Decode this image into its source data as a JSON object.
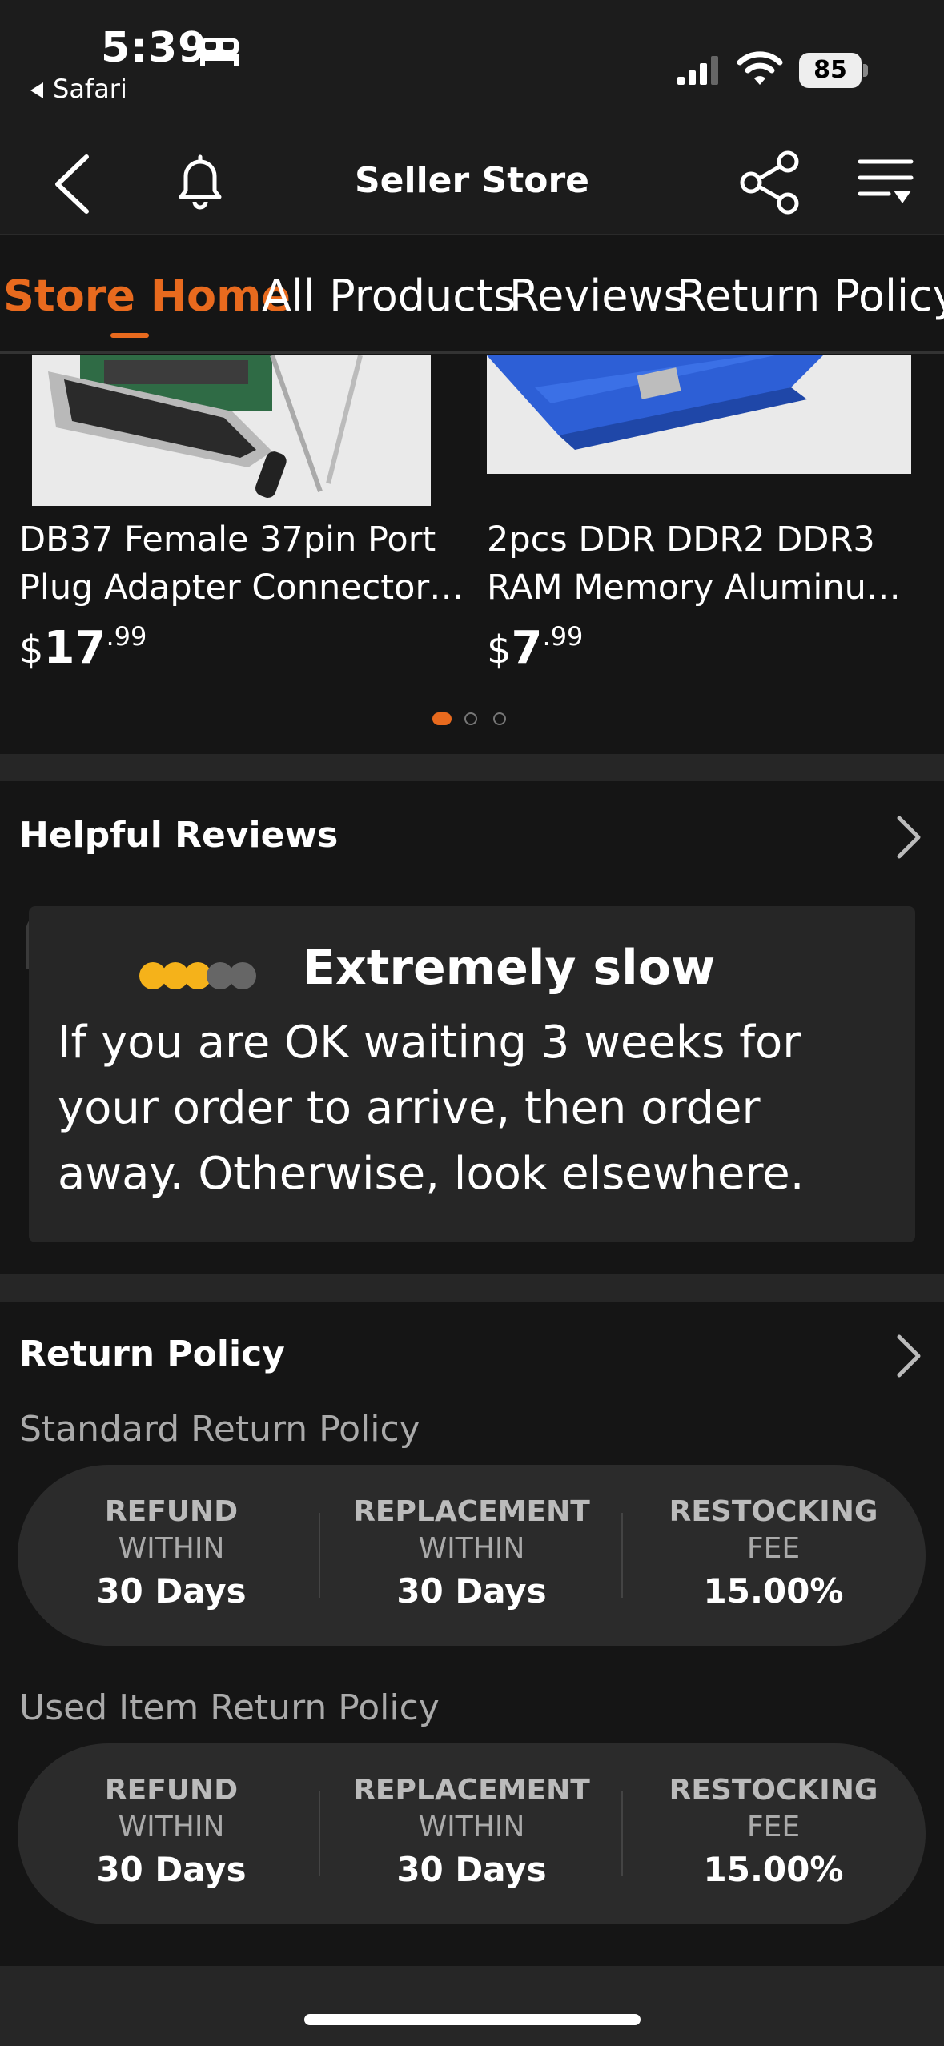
{
  "status_bar": {
    "time": "5:39",
    "back_app": "Safari",
    "battery": "85"
  },
  "nav": {
    "title": "Seller Store"
  },
  "tabs": [
    {
      "label": "Store Home",
      "active": true
    },
    {
      "label": "All Products",
      "active": false
    },
    {
      "label": "Reviews",
      "active": false
    },
    {
      "label": "Return Policy",
      "active": false
    }
  ],
  "products": [
    {
      "name_line1": "DB37 Female 37pin Port",
      "name_line2": "Plug Adapter Connector…",
      "currency": "$",
      "price_whole": "17",
      "price_cents": ".99"
    },
    {
      "name_line1": "2pcs DDR DDR2 DDR3",
      "name_line2": "RAM Memory Aluminu…",
      "currency": "$",
      "price_whole": "7",
      "price_cents": ".99"
    }
  ],
  "carousel": {
    "pages": 3,
    "active_page": 1
  },
  "reviews": {
    "section_title": "Helpful Reviews",
    "rating": 3,
    "rating_max": 5,
    "review_title": "Extremely slow",
    "review_line1": "If you are OK waiting 3 weeks for",
    "review_line2": "your order to arrive, then order",
    "review_line3": "away.  Otherwise, look elsewhere."
  },
  "return_policy": {
    "section_title": "Return Policy",
    "policies": [
      {
        "label": "Standard Return Policy",
        "columns": [
          {
            "head": "REFUND",
            "sub": "WITHIN",
            "value": "30 Days"
          },
          {
            "head": "REPLACEMENT",
            "sub": "WITHIN",
            "value": "30 Days"
          },
          {
            "head": "RESTOCKING",
            "sub": "FEE",
            "value": "15.00%"
          }
        ]
      },
      {
        "label": "Used Item Return Policy",
        "columns": [
          {
            "head": "REFUND",
            "sub": "WITHIN",
            "value": "30 Days"
          },
          {
            "head": "REPLACEMENT",
            "sub": "WITHIN",
            "value": "30 Days"
          },
          {
            "head": "RESTOCKING",
            "sub": "FEE",
            "value": "15.00%"
          }
        ]
      }
    ]
  },
  "colors": {
    "accent": "#e86a1e",
    "rating_on": "#f5b21a",
    "rating_off": "#666666",
    "background": "#151515",
    "card": "#262626"
  }
}
